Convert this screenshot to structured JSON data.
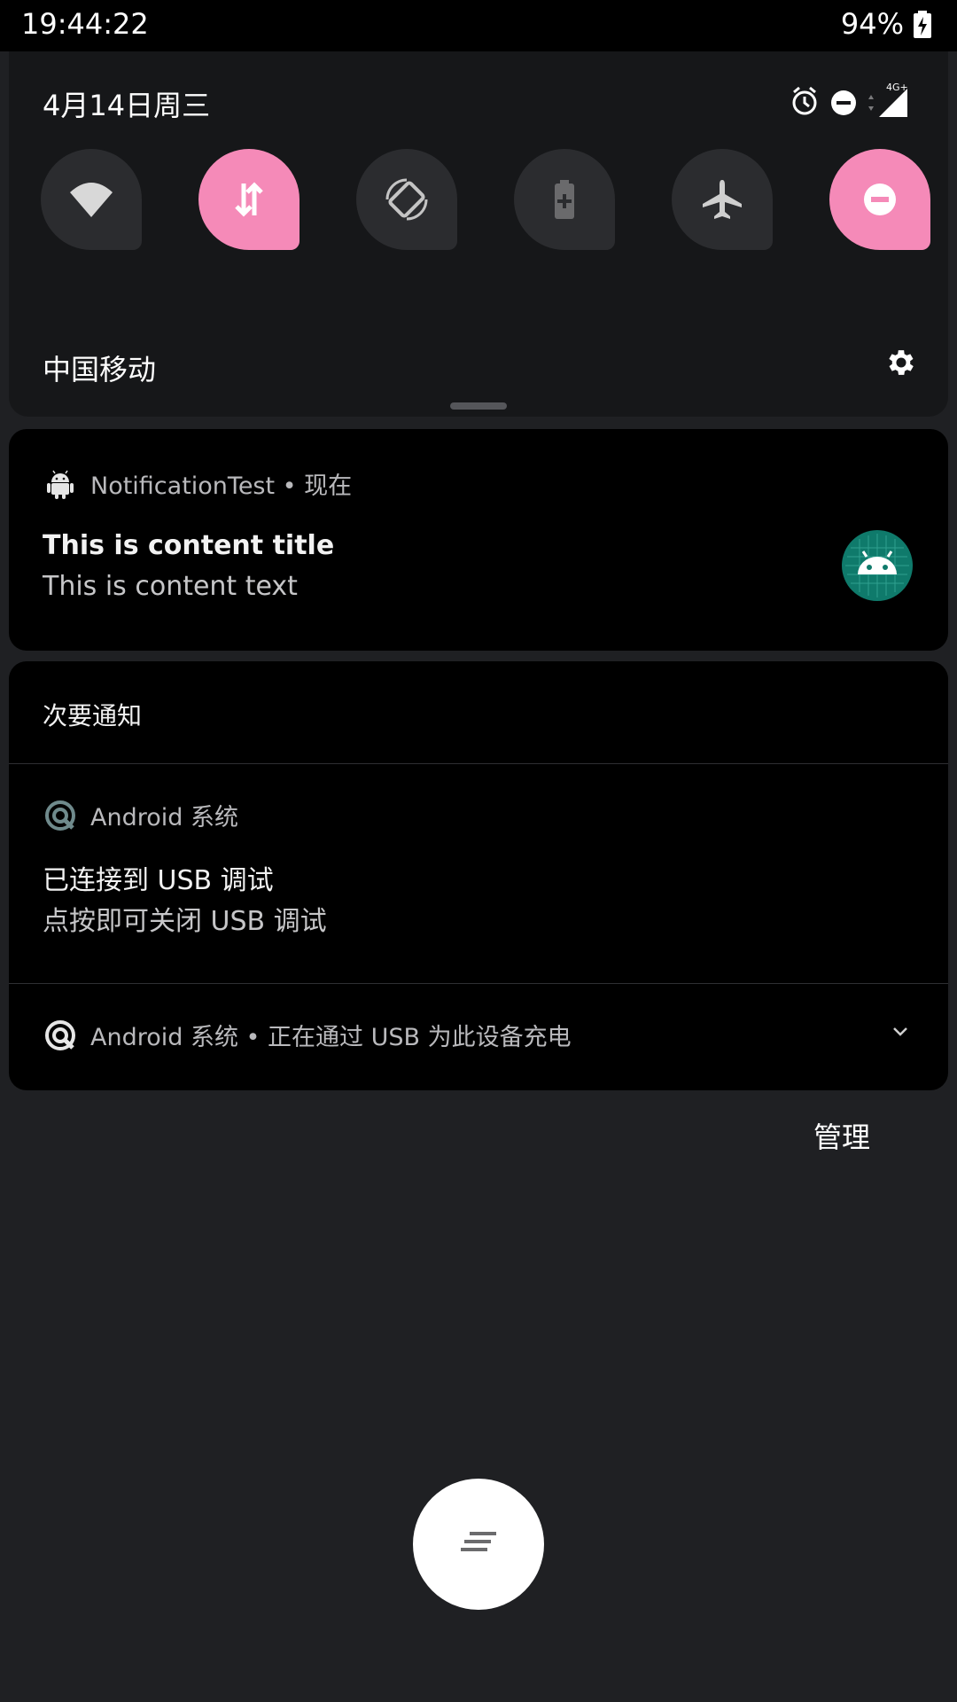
{
  "status_bar": {
    "time": "19:44:22",
    "battery": "94%"
  },
  "quick_settings": {
    "date": "4月14日周三",
    "network_type": "4G+",
    "carrier": "中国移动",
    "tiles": [
      {
        "name": "wifi",
        "icon": "wifi-icon",
        "active": false
      },
      {
        "name": "mobile-data",
        "icon": "data-arrows-icon",
        "active": true
      },
      {
        "name": "auto-rotate",
        "icon": "rotate-icon",
        "active": false
      },
      {
        "name": "battery-saver",
        "icon": "battery-plus-icon",
        "active": false
      },
      {
        "name": "airplane-mode",
        "icon": "airplane-icon",
        "active": false
      },
      {
        "name": "do-not-disturb",
        "icon": "dnd-icon",
        "active": true
      }
    ]
  },
  "notification": {
    "app": "NotificationTest • 现在",
    "title": "This is content title",
    "text": "This is content text"
  },
  "silent_group": {
    "title": "次要通知",
    "usb_debug": {
      "app": "Android 系统",
      "title": "已连接到 USB 调试",
      "text": "点按即可关闭 USB 调试"
    },
    "charging": {
      "app": "Android 系统 • 正在通过 USB 为此设备充电"
    }
  },
  "manage_label": "管理",
  "colors": {
    "accent_pink": "#f58ab8",
    "panel": "#161719",
    "card": "#000000",
    "background": "#1f2023",
    "android_teal": "#0f7a6b"
  }
}
